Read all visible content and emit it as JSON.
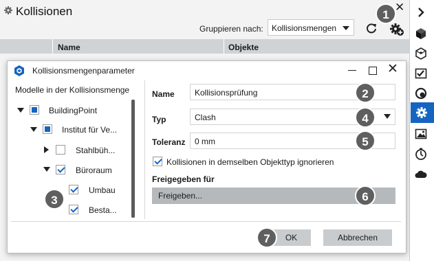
{
  "panel": {
    "title": "Kollisionen",
    "group_by_label": "Gruppieren nach:",
    "group_by_value": "Kollisionsmengen",
    "columns": [
      "Name",
      "Objekte"
    ]
  },
  "dialog": {
    "title": "Kollisionsmengenparameter",
    "tree_title": "Modelle in der Kollisionsmenge",
    "tree": [
      {
        "label": "BuildingPoint",
        "state": "partial",
        "expand": "down"
      },
      {
        "label": "Institut für Ve...",
        "state": "partial",
        "expand": "down"
      },
      {
        "label": "Stahlbüh...",
        "state": "unchecked",
        "expand": "right"
      },
      {
        "label": "Büroraum",
        "state": "checked",
        "expand": "down"
      },
      {
        "label": "Umbau",
        "state": "checked",
        "expand": "none"
      },
      {
        "label": "Besta...",
        "state": "checked",
        "expand": "none"
      }
    ],
    "name_label": "Name",
    "name_value": "Kollisionsprüfung",
    "type_label": "Typ",
    "type_value": "Clash",
    "tolerance_label": "Toleranz",
    "tolerance_value": "0 mm",
    "ignore_same_type_label": "Kollisionen in demselben Objekttyp ignorieren",
    "ignore_same_type_checked": true,
    "shared_label": "Freigegeben für",
    "share_button": "Freigeben...",
    "ok": "OK",
    "cancel": "Abbrechen"
  },
  "callouts": [
    "1",
    "2",
    "3",
    "4",
    "5",
    "6",
    "7"
  ],
  "sidebar": {
    "items": [
      {
        "icon": "chevron-right-icon"
      },
      {
        "icon": "cube-icon"
      },
      {
        "icon": "box-icon"
      },
      {
        "icon": "checklist-icon"
      },
      {
        "icon": "rings-icon"
      },
      {
        "icon": "clash-gear-icon",
        "active": true
      },
      {
        "icon": "image-icon"
      },
      {
        "icon": "timer-icon"
      },
      {
        "icon": "cloud-icon"
      }
    ]
  },
  "colors": {
    "accent": "#1565c0",
    "active_sidebar": "#1565c0",
    "badge": "#5f5f5f"
  }
}
